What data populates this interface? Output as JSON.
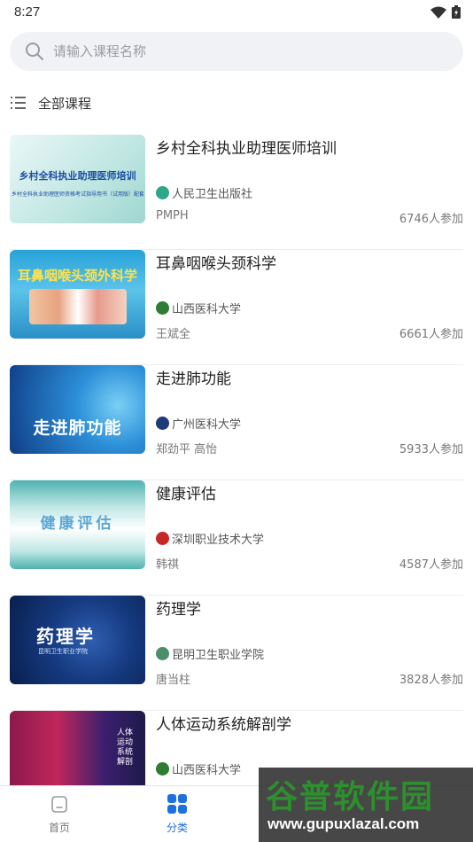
{
  "status_bar": {
    "time": "8:27"
  },
  "search": {
    "placeholder": "请输入课程名称",
    "value": ""
  },
  "all_courses": {
    "label": "全部课程"
  },
  "courses": [
    {
      "title": "乡村全科执业助理医师培训",
      "thumb_text": "乡村全科执业助理医师培训",
      "thumb_sub": "乡村全科执业助理医师资格考试指导用书（试用版）配套课",
      "org": "人民卫生出版社",
      "teacher": "PMPH",
      "count": "6746人参加"
    },
    {
      "title": "耳鼻咽喉头颈科学",
      "thumb_text": "耳鼻咽喉头颈外科学",
      "org": "山西医科大学",
      "teacher": "王斌全",
      "count": "6661人参加"
    },
    {
      "title": "走进肺功能",
      "thumb_text": "走进肺功能",
      "org": "广州医科大学",
      "teacher": "郑劲平 高怡",
      "count": "5933人参加"
    },
    {
      "title": "健康评估",
      "thumb_text": "健康评估",
      "org": "深圳职业技术大学",
      "teacher": "韩祺",
      "count": "4587人参加"
    },
    {
      "title": "药理学",
      "thumb_text": "药理学",
      "thumb_sub": "昆明卫生职业学院",
      "org": "昆明卫生职业学院",
      "teacher": "唐当柱",
      "count": "3828人参加"
    },
    {
      "title": "人体运动系统解剖学",
      "thumb_text": "人体运动系统解剖",
      "org": "山西医科大学",
      "teacher": "",
      "count": ""
    }
  ],
  "bottom_nav": {
    "home": "首页",
    "category": "分类"
  },
  "watermark": {
    "text": "谷普软件园",
    "url": "www.gupuxlazal.com"
  }
}
